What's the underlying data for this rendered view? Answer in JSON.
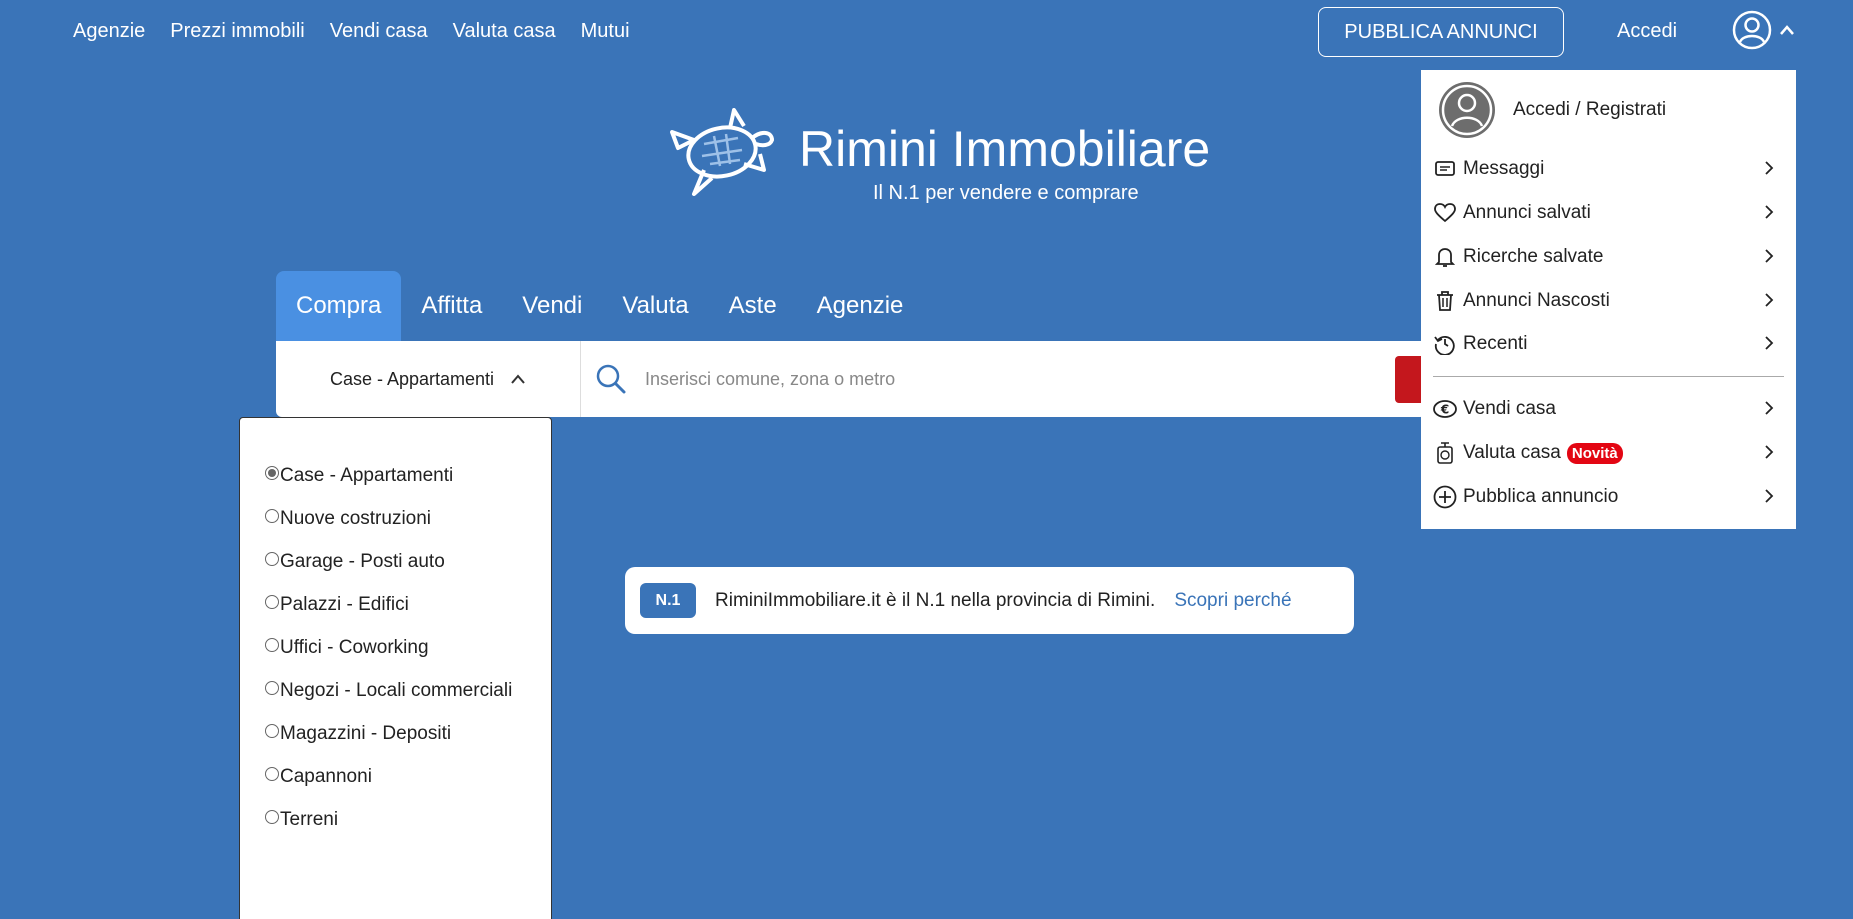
{
  "topnav": {
    "links": [
      "Agenzie",
      "Prezzi immobili",
      "Vendi casa",
      "Valuta casa",
      "Mutui"
    ],
    "publish_button": "PUBBLICA ANNUNCI",
    "login_link": "Accedi"
  },
  "brand": {
    "title": "Rimini Immobiliare",
    "tagline": "Il N.1 per vendere e comprare"
  },
  "tabs": [
    "Compra",
    "Affitta",
    "Vendi",
    "Valuta",
    "Aste",
    "Agenzie"
  ],
  "search": {
    "category_selected": "Case - Appartamenti",
    "placeholder": "Inserisci comune, zona o metro"
  },
  "category_options": [
    {
      "label": "Case - Appartamenti",
      "checked": true
    },
    {
      "label": "Nuove costruzioni",
      "checked": false
    },
    {
      "label": "Garage - Posti auto",
      "checked": false
    },
    {
      "label": "Palazzi - Edifici",
      "checked": false
    },
    {
      "label": "Uffici - Coworking",
      "checked": false
    },
    {
      "label": "Negozi - Locali commerciali",
      "checked": false
    },
    {
      "label": "Magazzini - Depositi",
      "checked": false
    },
    {
      "label": "Capannoni",
      "checked": false
    },
    {
      "label": "Terreni",
      "checked": false
    }
  ],
  "banner": {
    "badge": "N.1",
    "text": "RiminiImmobiliare.it è il N.1 nella provincia di Rimini.",
    "link": "Scopri perché"
  },
  "user_menu": {
    "header": "Accedi / Registrati",
    "items": [
      {
        "label": "Messaggi",
        "icon": "message-icon"
      },
      {
        "label": "Annunci salvati",
        "icon": "heart-icon"
      },
      {
        "label": "Ricerche salvate",
        "icon": "bell-icon"
      },
      {
        "label": "Annunci Nascosti",
        "icon": "trash-icon"
      },
      {
        "label": "Recenti",
        "icon": "history-icon"
      }
    ],
    "items2": [
      {
        "label": "Vendi casa",
        "icon": "euro-icon"
      },
      {
        "label": "Valuta casa",
        "icon": "scale-icon",
        "badge": "Novità"
      },
      {
        "label": "Pubblica annuncio",
        "icon": "plus-circle-icon"
      }
    ]
  },
  "colors": {
    "background": "#3a74b8",
    "active_tab": "#4a90e2",
    "search_button": "#c4171d",
    "badge_red": "#e30613"
  }
}
